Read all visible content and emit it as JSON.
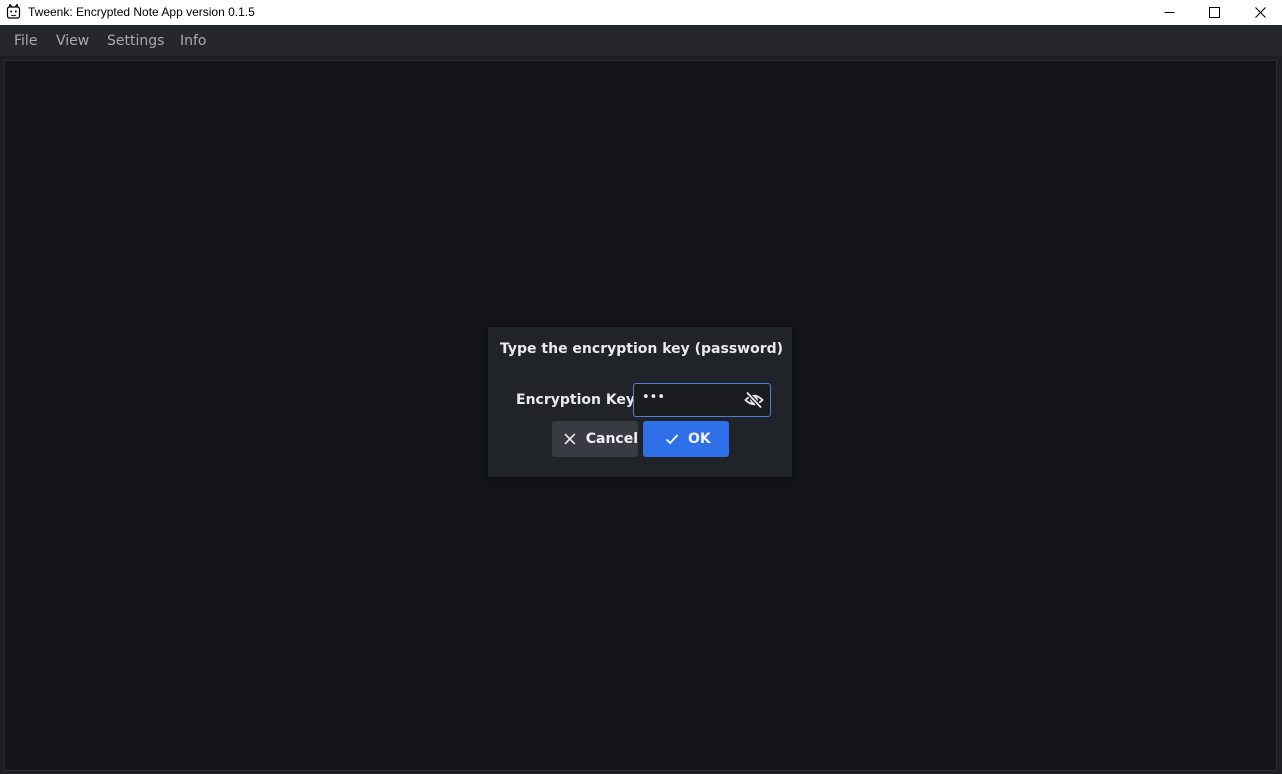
{
  "window": {
    "title": "Tweenk: Encrypted Note App version 0.1.5",
    "controls": [
      "minimize-icon",
      "maximize-icon",
      "close-icon"
    ]
  },
  "menu": {
    "items": [
      {
        "label": "File"
      },
      {
        "label": "View"
      },
      {
        "label": "Settings"
      },
      {
        "label": "Info"
      }
    ]
  },
  "dialog": {
    "title": "Type the encryption key (password)",
    "field_label": "Encryption Key",
    "field_value": "•••",
    "toggle_icon": "eye-off-icon",
    "cancel_label": "Cancel",
    "ok_label": "OK"
  },
  "colors": {
    "background": "#141519",
    "menubar": "#26272b",
    "dialog": "#202328",
    "accent": "#2f6fe8",
    "input_border": "#4f7ee0",
    "secondary_button": "#383b41"
  }
}
